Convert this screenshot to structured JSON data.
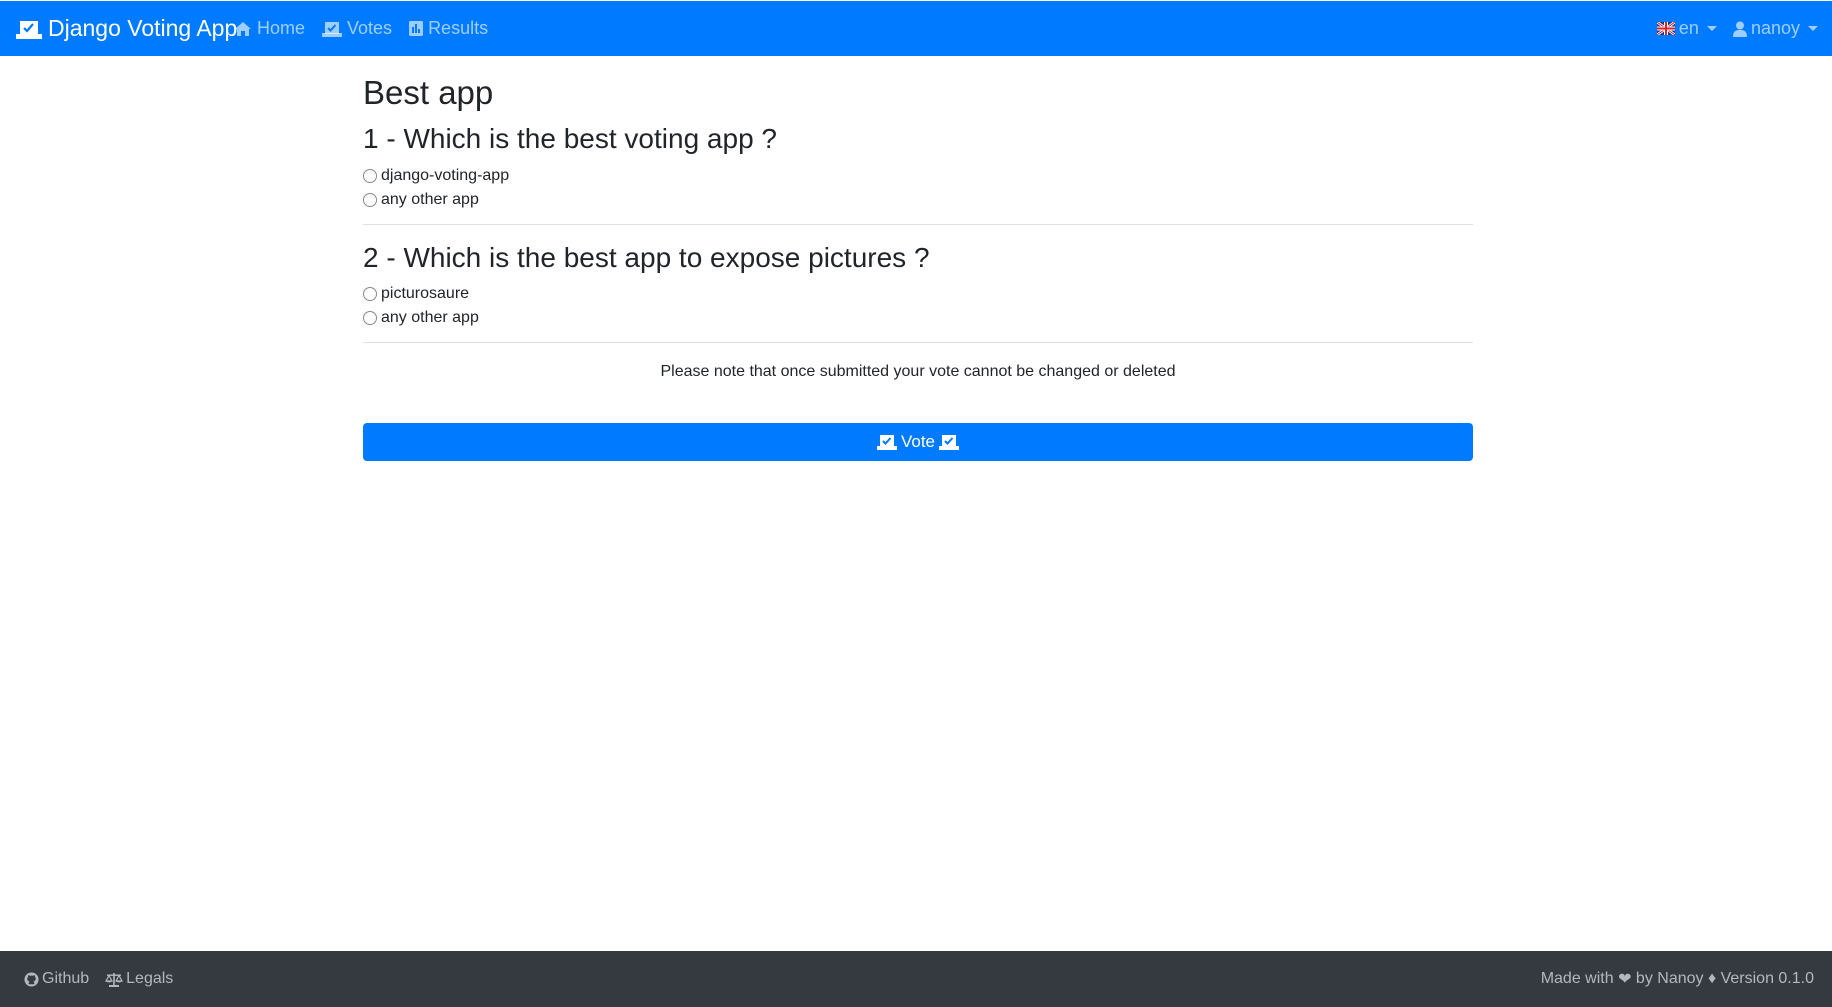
{
  "navbar": {
    "brand": "Django Voting App",
    "brand_icon": "vote-yea-icon",
    "links": [
      {
        "label": "Home",
        "icon": "home-icon"
      },
      {
        "label": "Votes",
        "icon": "vote-yea-icon"
      },
      {
        "label": "Results",
        "icon": "poll-icon"
      }
    ],
    "language": {
      "label": "en",
      "icon": "uk-flag-icon"
    },
    "user": {
      "label": "nanoy",
      "icon": "user-icon"
    },
    "background": "#007bff"
  },
  "poll": {
    "title": "Best app",
    "questions": [
      {
        "title": "1 - Which is the best voting app ?",
        "choices": [
          "django-voting-app",
          "any other app"
        ]
      },
      {
        "title": "2 - Which is the best app to expose pictures ?",
        "choices": [
          "picturosaure",
          "any other app"
        ]
      }
    ],
    "notice": "Please note that once submitted your vote cannot be changed or deleted",
    "vote_button": "Vote"
  },
  "footer": {
    "links": [
      {
        "label": "Github",
        "icon": "github-icon"
      },
      {
        "label": "Legals",
        "icon": "balance-scale-icon"
      }
    ],
    "made_with": "Made with",
    "heart": "❤",
    "by": "by Nanoy",
    "separator": "♦",
    "version": "Version 0.1.0",
    "background": "#343a40"
  }
}
